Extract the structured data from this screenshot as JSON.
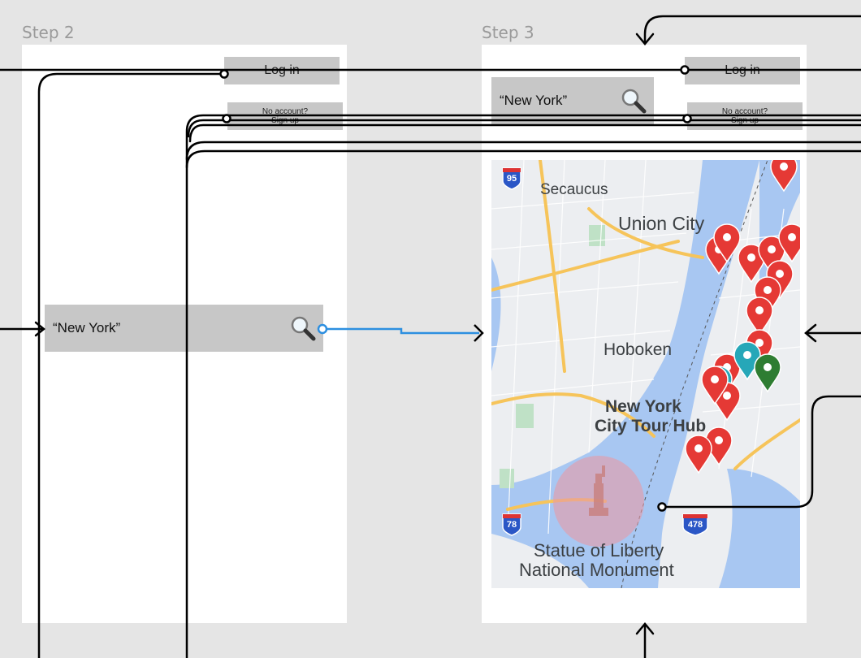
{
  "steps": {
    "step2": {
      "label": "Step 2",
      "login_label": "Log in",
      "signup_line1": "No account?",
      "signup_line2": "Sign up",
      "search_value": "“New York”",
      "search_icon": "magnifier-icon"
    },
    "step3": {
      "label": "Step 3",
      "login_label": "Log in",
      "signup_line1": "No account?",
      "signup_line2": "Sign up",
      "search_value": "“New York”",
      "search_icon": "magnifier-icon"
    }
  },
  "map": {
    "places": [
      "Secaucus",
      "Union City",
      "Hoboken",
      "New York",
      "City Tour Hub",
      "Statue of Liberty",
      "National Monument"
    ],
    "highways": [
      "95",
      "78",
      "478"
    ],
    "colors": {
      "water": "#a8c7f2",
      "land": "#eceef1",
      "road": "#f6c45a",
      "pin_red": "#e53935",
      "pin_teal": "#26a7b8",
      "pin_green": "#2e7d32"
    }
  },
  "colors": {
    "canvas": "#e5e5e5",
    "frame": "#ffffff",
    "placeholder": "#c7c7c7",
    "connector": "#000000",
    "active_connector": "#2d8fe0"
  }
}
